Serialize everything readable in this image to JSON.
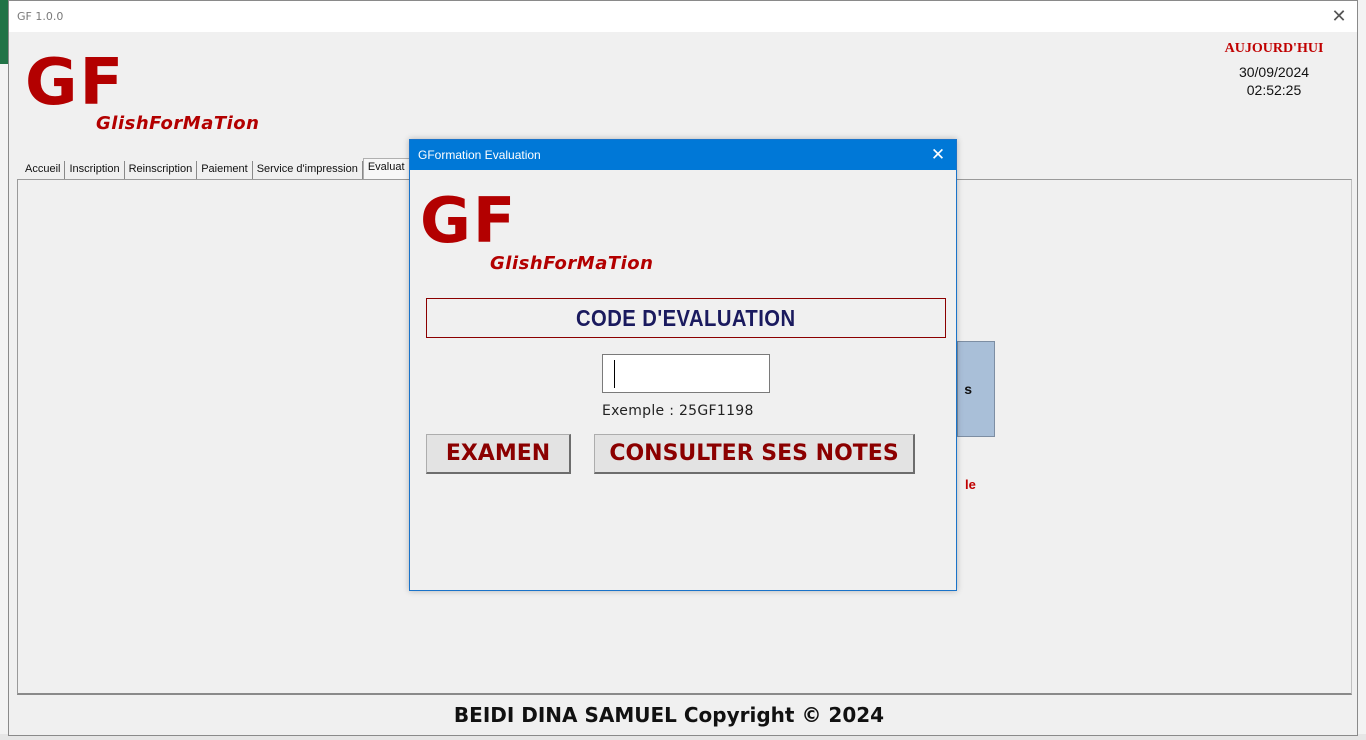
{
  "app": {
    "window_title": "GF 1.0.0",
    "logo_big": "GF",
    "logo_sub": "GlishForMaTion"
  },
  "date": {
    "label": "AUJOURD'HUI",
    "date": "30/09/2024",
    "time": "02:52:25"
  },
  "tabs": [
    {
      "label": "Accueil"
    },
    {
      "label": "Inscription"
    },
    {
      "label": "Reinscription"
    },
    {
      "label": "Paiement"
    },
    {
      "label": "Service d'impression"
    },
    {
      "label": "Evaluat"
    }
  ],
  "background_partial": {
    "button_fragment": "s",
    "red_text_fragment": "le"
  },
  "footer": {
    "text": "BEIDI DINA SAMUEL Copyright © 2024"
  },
  "dialog": {
    "title": "GFormation Evaluation",
    "logo_big": "GF",
    "logo_sub": "GlishForMaTion",
    "code_header": "CODE D'EVALUATION",
    "code_value": "",
    "example_text": "Exemple : 25GF1198",
    "exam_button": "EXAMEN",
    "notes_button": "CONSULTER SES NOTES"
  },
  "colors": {
    "brand_red": "#b30000",
    "button_text": "#8b0000",
    "dialog_titlebar": "#0078d7",
    "header_text": "#1a1a5e"
  }
}
